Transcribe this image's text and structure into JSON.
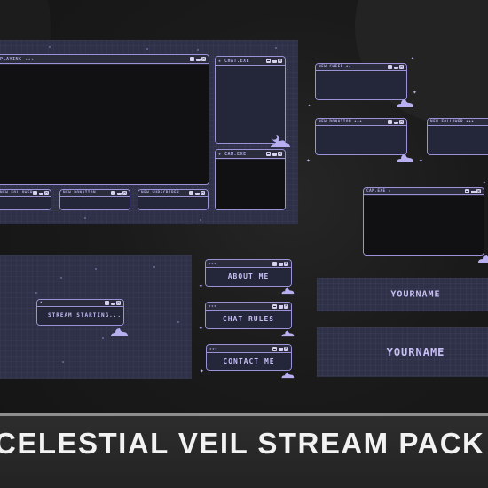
{
  "theme": {
    "accent": "#9c92d8",
    "panel": "#2e3148",
    "text_light": "#c6bdf5",
    "background": "#161616"
  },
  "main_overlay": {
    "game_window_title": "PLAYING ★★★",
    "chat_window_title": "★ CHAT.EXE",
    "cam_window_title": "★ CAM.EXE",
    "alert_boxes": [
      {
        "title": "NEW FOLLOWER"
      },
      {
        "title": "NEW DONATION"
      },
      {
        "title": "NEW SUBSCRIBER"
      }
    ]
  },
  "alerts": {
    "cheer": "NEW CHEER ••",
    "donation": "NEW DONATION •••",
    "follower": "NEW FOLLOWER •••"
  },
  "standalone_cam": {
    "title": "CAM.EXE ★"
  },
  "starting_screen": {
    "text": "STREAM STARTING...",
    "bar_icon": "•"
  },
  "panels": [
    {
      "stars": "★★★",
      "label": "ABOUT ME"
    },
    {
      "stars": "★★★",
      "label": "CHAT RULES"
    },
    {
      "stars": "★★★",
      "label": "CONTACT ME"
    }
  ],
  "name_bars": [
    {
      "text": "YOURNAME"
    },
    {
      "text": "YOURNAME"
    }
  ],
  "footer": {
    "title": "CELESTIAL VEIL STREAM PACK"
  },
  "icons": {
    "minimize": "minimize-icon",
    "maximize": "maximize-icon",
    "close": "close-icon",
    "cloud": "cloud-icon",
    "moon": "moon-icon",
    "sparkle": "sparkle-icon"
  }
}
